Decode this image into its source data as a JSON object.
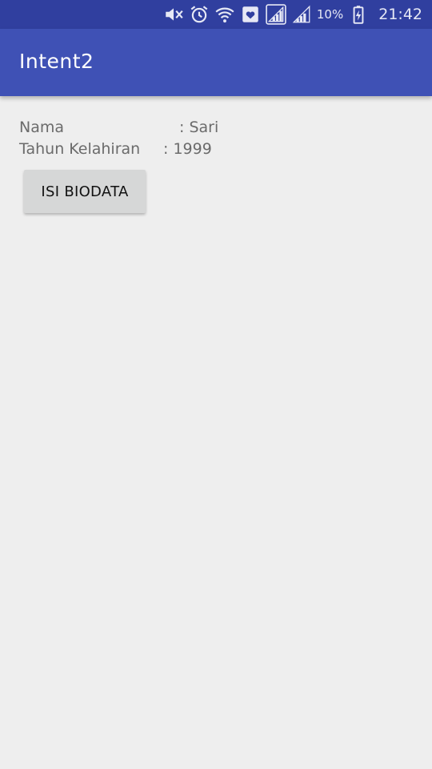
{
  "status_bar": {
    "icons": [
      "muted-speaker-icon",
      "alarm-clock-icon",
      "wifi-icon",
      "heart-notification-icon",
      "signal-strength-icon",
      "signal-strength-2-icon",
      "battery-charging-icon"
    ],
    "battery_percent": "10%",
    "time": "21:42",
    "bg_color": "#303f9f"
  },
  "app_bar": {
    "title": "Intent2",
    "bg_color": "#3f51b5"
  },
  "info": {
    "name_label": "Nama",
    "name_value": ": Sari",
    "year_label": "Tahun Kelahiran",
    "year_value": ": 1999"
  },
  "actions": {
    "fill_biodata_label": "ISI BIODATA"
  }
}
